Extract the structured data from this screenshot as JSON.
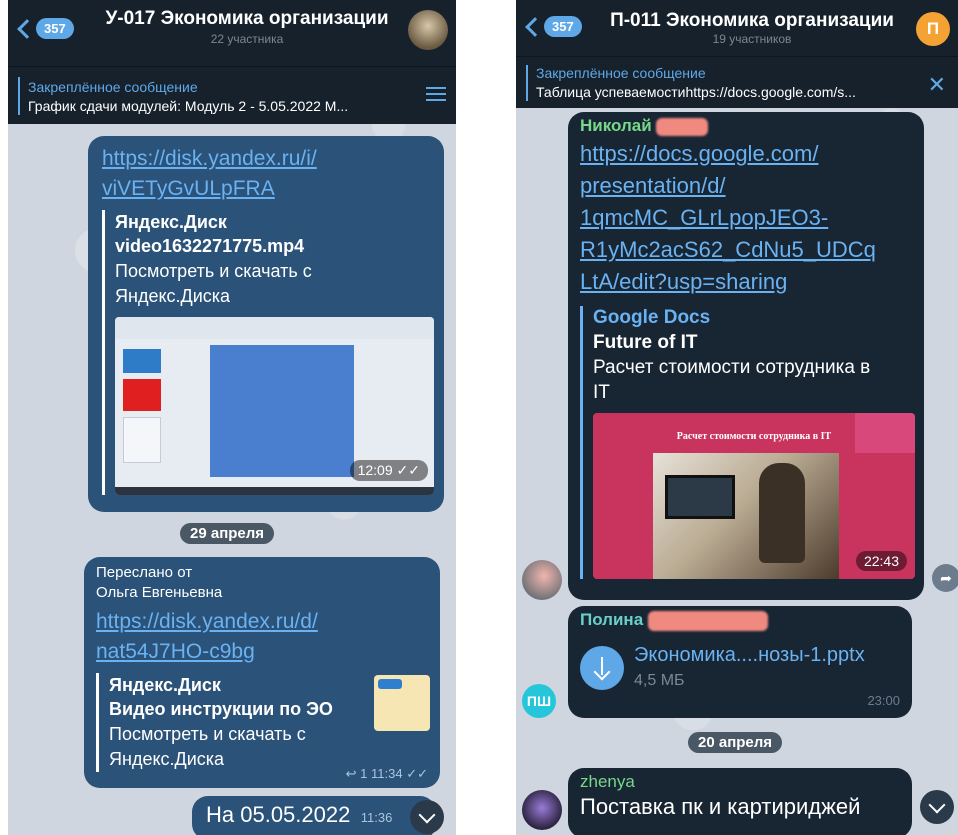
{
  "left": {
    "header": {
      "back_count": "357",
      "title": "У-017 Экономика организации",
      "subtitle": "22 участника"
    },
    "pinned": {
      "label": "Закреплённое сообщение",
      "text": "График сдачи модулей: Модуль 2 - 5.05.2022 М..."
    },
    "msg1": {
      "link_line1": "https://disk.yandex.ru/i/",
      "link_line2": "viVETyGvULpFRA",
      "site": "Яндекс.Диск",
      "title": "video1632271775.mp4",
      "desc_line1": "Посмотреть и скачать с",
      "desc_line2": "Яндекс.Диска",
      "time": "12:09"
    },
    "date_separator": "29 апреля",
    "msg2": {
      "forwarded_label": "Переслано от",
      "forwarded_from": "Ольга Евгеньевна",
      "link_line1": "https://disk.yandex.ru/d/",
      "link_line2": "nat54J7HO-c9bg",
      "site": "Яндекс.Диск",
      "title": "Видео инструкции по ЭО",
      "desc_line1": "Посмотреть и скачать с",
      "desc_line2": "Яндекс.Диска",
      "reply_count": "1",
      "time": "11:34"
    },
    "msg3": {
      "text": "На 05.05.2022",
      "time": "11:36"
    }
  },
  "right": {
    "header": {
      "back_count": "357",
      "title": "П-011 Экономика организации",
      "subtitle": "19 участников",
      "avatar_letter": "П"
    },
    "pinned": {
      "label": "Закреплённое сообщение",
      "text": "Таблица успеваемостиhttps://docs.google.com/s..."
    },
    "msg1": {
      "sender": "Николай",
      "link_lines": [
        "https://docs.google.com/",
        "presentation/d/",
        "1qmcMC_GLrLpopJEO3-",
        "R1yMc2acS62_CdNu5_UDCq",
        "LtA/edit?usp=sharing"
      ],
      "site": "Google Docs",
      "title": "Future of IT",
      "desc_line1": "Расчет стоимости сотрудника в",
      "desc_line2": "IT",
      "image_caption": "Расчет стоимости сотрудника в IT",
      "time": "22:43"
    },
    "msg2": {
      "sender": "Полина",
      "avatar_initials": "ПШ",
      "file_name": "Экономика....нозы-1.pptx",
      "file_size": "4,5 МБ",
      "time": "23:00"
    },
    "date_separator": "20 апреля",
    "msg3": {
      "sender": "zhenya",
      "text": "Поставка пк и картириджей"
    }
  },
  "colors": {
    "header_bg": "#17212b",
    "bubble_out": "#2b5278",
    "bubble_in": "#182533",
    "accent": "#5fa8e8",
    "link": "#6ab2f2"
  },
  "icons": [
    "back-chevron-icon",
    "pinned-list-icon",
    "close-icon",
    "double-check-icon",
    "scroll-down-icon",
    "download-icon",
    "share-icon",
    "reply-icon"
  ]
}
